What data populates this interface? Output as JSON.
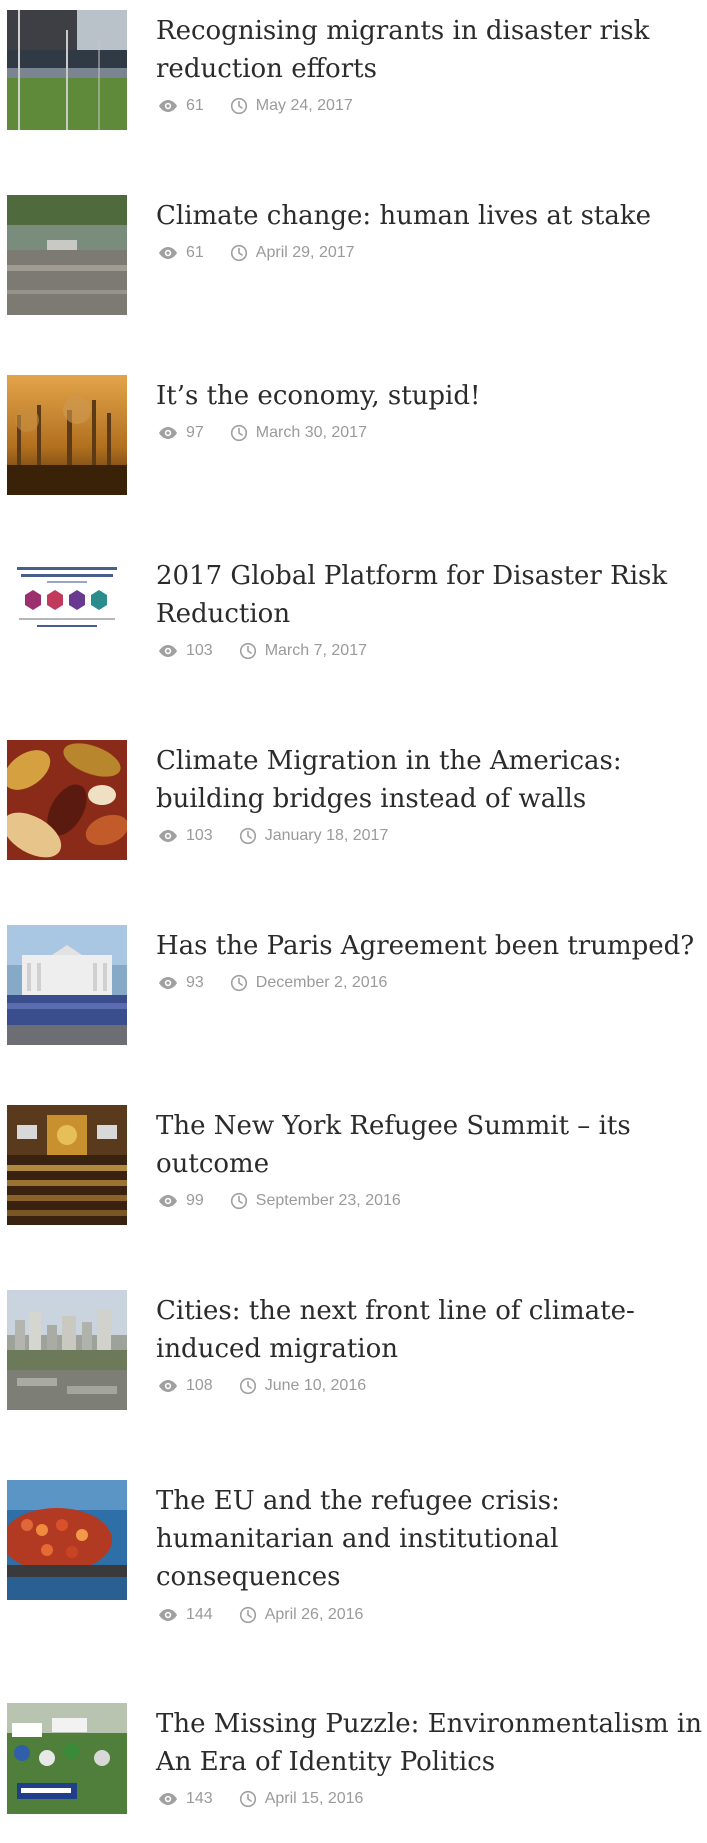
{
  "posts": [
    {
      "title_lines": [
        "Recognising migrants in disaster risk",
        "reduction efforts"
      ],
      "views": "61",
      "date": "May 24, 2017",
      "thumb": "people-fence-photo"
    },
    {
      "title_lines": [
        "Climate change: human lives at stake"
      ],
      "views": "61",
      "date": "April 29, 2017",
      "thumb": "flood-photo"
    },
    {
      "title_lines": [
        "It’s the economy, stupid!"
      ],
      "views": "97",
      "date": "March 30, 2017",
      "thumb": "industry-smog-photo"
    },
    {
      "title_lines": [
        "2017 Global Platform for Disaster Risk",
        "Reduction"
      ],
      "views": "103",
      "date": "March 7, 2017",
      "thumb": "global-platform-poster"
    },
    {
      "title_lines": [
        "Climate Migration in the Americas:",
        "building bridges instead of walls"
      ],
      "views": "103",
      "date": "January 18, 2017",
      "thumb": "corn-photo"
    },
    {
      "title_lines": [
        "Has the Paris Agreement been trumped?"
      ],
      "views": "93",
      "date": "December 2, 2016",
      "thumb": "white-house-photo"
    },
    {
      "title_lines": [
        "The New York Refugee Summit – its",
        "outcome"
      ],
      "views": "99",
      "date": "September 23, 2016",
      "thumb": "un-assembly-photo"
    },
    {
      "title_lines": [
        "Cities: the next front line of climate-",
        "induced migration"
      ],
      "views": "108",
      "date": "June 10, 2016",
      "thumb": "city-photo"
    },
    {
      "title_lines": [
        "The EU and the refugee crisis:",
        "humanitarian and institutional",
        "consequences"
      ],
      "views": "144",
      "date": "April 26, 2016",
      "thumb": "refugee-boat-photo"
    },
    {
      "title_lines": [
        "The Missing Puzzle: Environmentalism in",
        "An Era of Identity Politics"
      ],
      "views": "143",
      "date": "April 15, 2016",
      "thumb": "climate-march-photo"
    }
  ],
  "colors": {
    "title": "#2b2b2b",
    "meta": "#9a9a9a"
  },
  "icons": {
    "views": "eye-icon",
    "date": "clock-icon"
  }
}
